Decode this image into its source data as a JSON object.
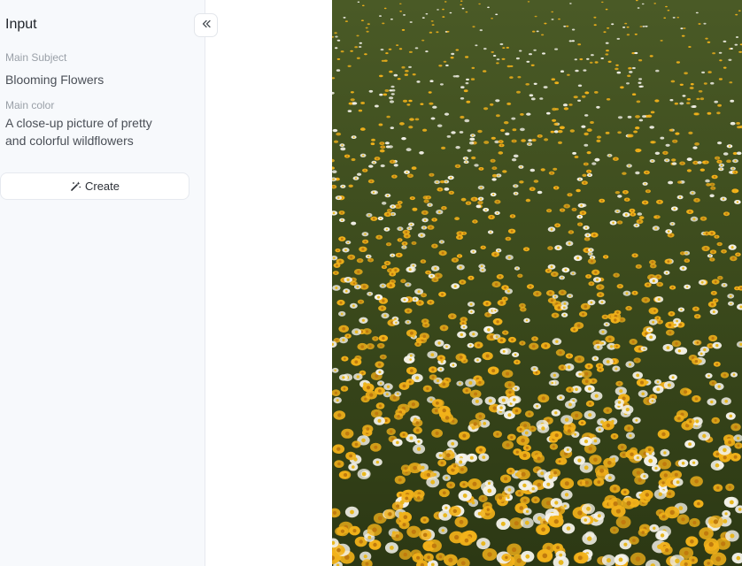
{
  "sidebar": {
    "title": "Input",
    "fields": [
      {
        "label": "Main Subject",
        "value": "Blooming Flowers"
      },
      {
        "label": "Main color",
        "value": "A close-up picture of pretty and colorful wildflowers"
      }
    ],
    "create_label": "Create",
    "create_icon": "magic-wand-icon",
    "collapse_icon": "chevrons-left-icon"
  },
  "generated_image": {
    "subject": "field of yellow and white wildflowers",
    "colors": {
      "background": "#3b4a1c",
      "yellow_flower": "#f2b21a",
      "white_flower": "#f4f2ea"
    }
  }
}
